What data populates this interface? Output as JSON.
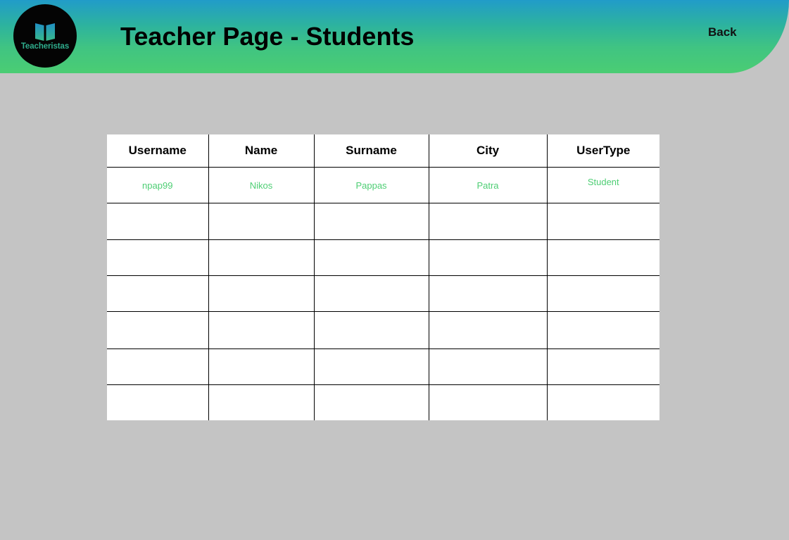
{
  "app": {
    "logo_name": "Teacheristas",
    "logo_icon": "open-book-icon"
  },
  "header": {
    "title": "Teacher Page - Students",
    "back_label": "Back"
  },
  "colors": {
    "header_gradient_top": "#219cc9",
    "header_gradient_bottom": "#4bcd73",
    "accent": "#4ece74",
    "page_background": "#c4c4c4"
  },
  "table": {
    "columns": [
      "Username",
      "Name",
      "Surname",
      "City",
      "UserType"
    ],
    "rows": [
      [
        "npap99",
        "Nikos",
        "Pappas",
        "Patra",
        "Student"
      ],
      [
        "",
        "",
        "",
        "",
        ""
      ],
      [
        "",
        "",
        "",
        "",
        ""
      ],
      [
        "",
        "",
        "",
        "",
        ""
      ],
      [
        "",
        "",
        "",
        "",
        ""
      ],
      [
        "",
        "",
        "",
        "",
        ""
      ],
      [
        "",
        "",
        "",
        "",
        ""
      ]
    ]
  }
}
